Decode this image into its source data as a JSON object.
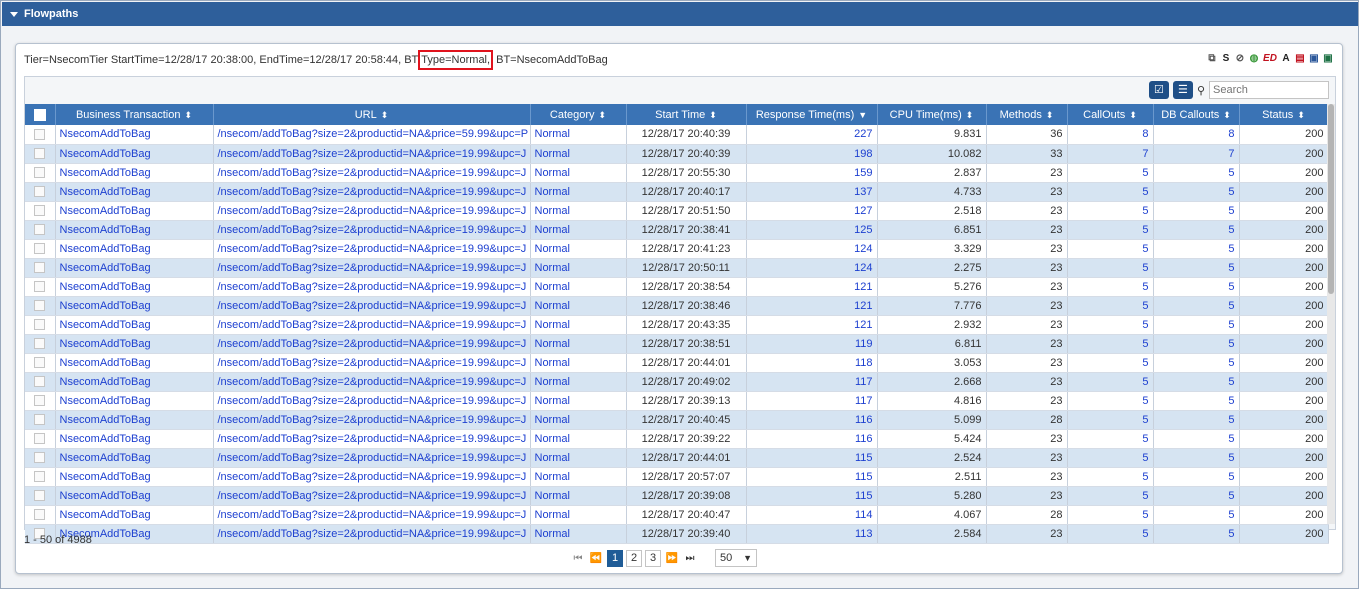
{
  "title": "Flowpaths",
  "info": {
    "prefix": "Tier=NsecomTier StartTime=12/28/17 20:38:00, EndTime=12/28/17 20:58:44, BT",
    "highlight": "Type=Normal,",
    "suffix": "BT=NsecomAddToBag"
  },
  "export_icons": [
    "copy-icon",
    "s-icon",
    "refresh-icon",
    "green-refresh-icon",
    "ed-icon",
    "font-icon",
    "pdf-icon",
    "word-icon",
    "excel-icon"
  ],
  "toolbar": {
    "search_placeholder": "Search"
  },
  "columns": [
    "Business Transaction",
    "URL",
    "Category",
    "Start Time",
    "Response Time(ms)",
    "CPU Time(ms)",
    "Methods",
    "CallOuts",
    "DB Callouts",
    "Status"
  ],
  "rows": [
    [
      "NsecomAddToBag",
      "/nsecom/addToBag?size=2&productid=NA&price=59.99&upc=P",
      "Normal",
      "12/28/17 20:40:39",
      "227",
      "9.831",
      "36",
      "8",
      "8",
      "200"
    ],
    [
      "NsecomAddToBag",
      "/nsecom/addToBag?size=2&productid=NA&price=19.99&upc=J",
      "Normal",
      "12/28/17 20:40:39",
      "198",
      "10.082",
      "33",
      "7",
      "7",
      "200"
    ],
    [
      "NsecomAddToBag",
      "/nsecom/addToBag?size=2&productid=NA&price=19.99&upc=J",
      "Normal",
      "12/28/17 20:55:30",
      "159",
      "2.837",
      "23",
      "5",
      "5",
      "200"
    ],
    [
      "NsecomAddToBag",
      "/nsecom/addToBag?size=2&productid=NA&price=19.99&upc=J",
      "Normal",
      "12/28/17 20:40:17",
      "137",
      "4.733",
      "23",
      "5",
      "5",
      "200"
    ],
    [
      "NsecomAddToBag",
      "/nsecom/addToBag?size=2&productid=NA&price=19.99&upc=J",
      "Normal",
      "12/28/17 20:51:50",
      "127",
      "2.518",
      "23",
      "5",
      "5",
      "200"
    ],
    [
      "NsecomAddToBag",
      "/nsecom/addToBag?size=2&productid=NA&price=19.99&upc=J",
      "Normal",
      "12/28/17 20:38:41",
      "125",
      "6.851",
      "23",
      "5",
      "5",
      "200"
    ],
    [
      "NsecomAddToBag",
      "/nsecom/addToBag?size=2&productid=NA&price=19.99&upc=J",
      "Normal",
      "12/28/17 20:41:23",
      "124",
      "3.329",
      "23",
      "5",
      "5",
      "200"
    ],
    [
      "NsecomAddToBag",
      "/nsecom/addToBag?size=2&productid=NA&price=19.99&upc=J",
      "Normal",
      "12/28/17 20:50:11",
      "124",
      "2.275",
      "23",
      "5",
      "5",
      "200"
    ],
    [
      "NsecomAddToBag",
      "/nsecom/addToBag?size=2&productid=NA&price=19.99&upc=J",
      "Normal",
      "12/28/17 20:38:54",
      "121",
      "5.276",
      "23",
      "5",
      "5",
      "200"
    ],
    [
      "NsecomAddToBag",
      "/nsecom/addToBag?size=2&productid=NA&price=19.99&upc=J",
      "Normal",
      "12/28/17 20:38:46",
      "121",
      "7.776",
      "23",
      "5",
      "5",
      "200"
    ],
    [
      "NsecomAddToBag",
      "/nsecom/addToBag?size=2&productid=NA&price=19.99&upc=J",
      "Normal",
      "12/28/17 20:43:35",
      "121",
      "2.932",
      "23",
      "5",
      "5",
      "200"
    ],
    [
      "NsecomAddToBag",
      "/nsecom/addToBag?size=2&productid=NA&price=19.99&upc=J",
      "Normal",
      "12/28/17 20:38:51",
      "119",
      "6.811",
      "23",
      "5",
      "5",
      "200"
    ],
    [
      "NsecomAddToBag",
      "/nsecom/addToBag?size=2&productid=NA&price=19.99&upc=J",
      "Normal",
      "12/28/17 20:44:01",
      "118",
      "3.053",
      "23",
      "5",
      "5",
      "200"
    ],
    [
      "NsecomAddToBag",
      "/nsecom/addToBag?size=2&productid=NA&price=19.99&upc=J",
      "Normal",
      "12/28/17 20:49:02",
      "117",
      "2.668",
      "23",
      "5",
      "5",
      "200"
    ],
    [
      "NsecomAddToBag",
      "/nsecom/addToBag?size=2&productid=NA&price=19.99&upc=J",
      "Normal",
      "12/28/17 20:39:13",
      "117",
      "4.816",
      "23",
      "5",
      "5",
      "200"
    ],
    [
      "NsecomAddToBag",
      "/nsecom/addToBag?size=2&productid=NA&price=19.99&upc=J",
      "Normal",
      "12/28/17 20:40:45",
      "116",
      "5.099",
      "28",
      "5",
      "5",
      "200"
    ],
    [
      "NsecomAddToBag",
      "/nsecom/addToBag?size=2&productid=NA&price=19.99&upc=J",
      "Normal",
      "12/28/17 20:39:22",
      "116",
      "5.424",
      "23",
      "5",
      "5",
      "200"
    ],
    [
      "NsecomAddToBag",
      "/nsecom/addToBag?size=2&productid=NA&price=19.99&upc=J",
      "Normal",
      "12/28/17 20:44:01",
      "115",
      "2.524",
      "23",
      "5",
      "5",
      "200"
    ],
    [
      "NsecomAddToBag",
      "/nsecom/addToBag?size=2&productid=NA&price=19.99&upc=J",
      "Normal",
      "12/28/17 20:57:07",
      "115",
      "2.511",
      "23",
      "5",
      "5",
      "200"
    ],
    [
      "NsecomAddToBag",
      "/nsecom/addToBag?size=2&productid=NA&price=19.99&upc=J",
      "Normal",
      "12/28/17 20:39:08",
      "115",
      "5.280",
      "23",
      "5",
      "5",
      "200"
    ],
    [
      "NsecomAddToBag",
      "/nsecom/addToBag?size=2&productid=NA&price=19.99&upc=J",
      "Normal",
      "12/28/17 20:40:47",
      "114",
      "4.067",
      "28",
      "5",
      "5",
      "200"
    ],
    [
      "NsecomAddToBag",
      "/nsecom/addToBag?size=2&productid=NA&price=19.99&upc=J",
      "Normal",
      "12/28/17 20:39:40",
      "113",
      "2.584",
      "23",
      "5",
      "5",
      "200"
    ]
  ],
  "record_count": "1 - 50 of 4988",
  "pager": {
    "pages": [
      "1",
      "2",
      "3"
    ],
    "active_page": "1",
    "page_size": "50"
  }
}
